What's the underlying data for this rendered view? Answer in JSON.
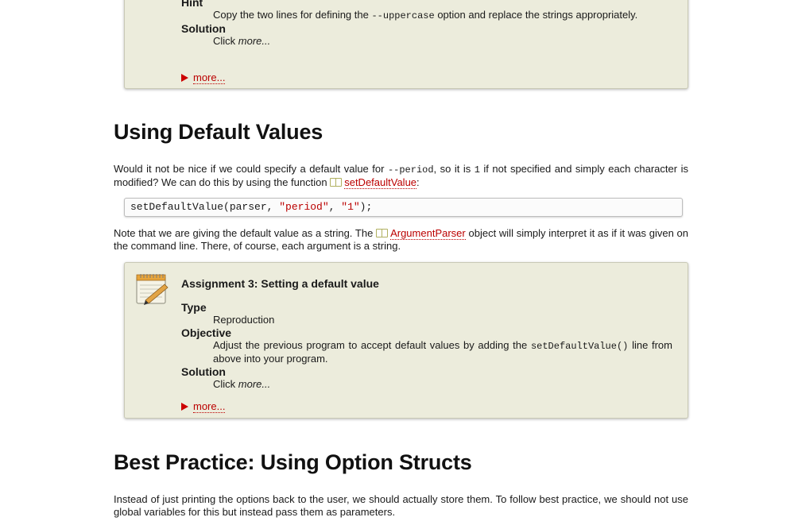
{
  "box1": {
    "hint_label": "Hint",
    "hint_text_1": "Copy the two lines for defining the",
    "hint_code": "--uppercase",
    "hint_text_2": "option and replace the strings appropriately.",
    "solution_label": "Solution",
    "solution_click": "Click",
    "solution_more": "more...",
    "more_link": "more..."
  },
  "section1": {
    "title": "Using Default Values",
    "para1_a": "Would it not be nice if we could specify a default value for",
    "para1_code1": "--period",
    "para1_b": ", so it is",
    "para1_code2": "1",
    "para1_c": "if not specified and simply each character is modified? We can do this by using the function",
    "para1_link": "setDefaultValue",
    "para1_d": ":",
    "code_fn": "setDefaultValue(parser, ",
    "code_str1": "\"period\"",
    "code_sep": ", ",
    "code_str2": "\"1\"",
    "code_end": ");",
    "para2_a": "Note that we are giving the default value as a string. The",
    "para2_link": "ArgumentParser",
    "para2_b": "object will simply interpret it as if it was given on the command line. There, of course, each argument is a string."
  },
  "assignment": {
    "title": "Assignment 3: Setting a default value",
    "type_label": "Type",
    "type_value": "Reproduction",
    "objective_label": "Objective",
    "objective_text": "Adjust the previous program to accept default values by adding the",
    "objective_code": "setDefaultValue()",
    "objective_text_2": "line from above into your program.",
    "solution_label": "Solution",
    "solution_click": "Click",
    "solution_more": "more...",
    "more_link": "more..."
  },
  "section2": {
    "title": "Best Practice: Using Option Structs",
    "para": "Instead of just printing the options back to the user, we should actually store them. To follow best practice, we should not use global variables for this but instead pass them as parameters."
  }
}
